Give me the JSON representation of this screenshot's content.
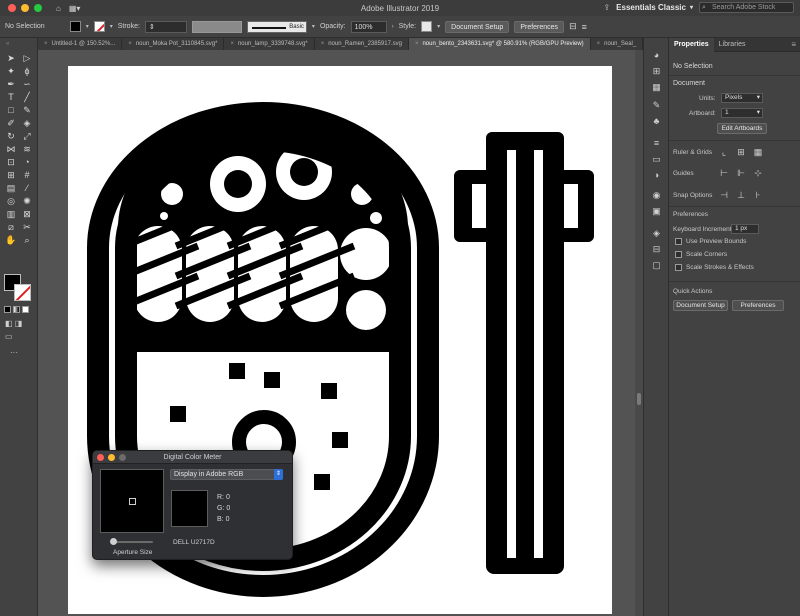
{
  "window": {
    "title": "Adobe Illustrator 2019",
    "workspace": "Essentials Classic",
    "stock_search_placeholder": "Search Adobe Stock"
  },
  "control_bar": {
    "selection": "No Selection",
    "stroke_label": "Stroke:",
    "stroke_style": "Basic",
    "opacity_label": "Opacity:",
    "opacity_value": "100%",
    "style_label": "Style:",
    "document_setup": "Document Setup",
    "preferences": "Preferences"
  },
  "tabs": [
    {
      "label": "Untitled-1 @ 150.52%...",
      "active": false
    },
    {
      "label": "noun_Moka Pot_3110845.svg*",
      "active": false
    },
    {
      "label": "noun_lamp_3339748.svg*",
      "active": false
    },
    {
      "label": "noun_Ramen_2385917.svg",
      "active": false
    },
    {
      "label": "noun_bento_2343631.svg* @ 580.91% (RGB/GPU Preview)",
      "active": true
    },
    {
      "label": "noun_Seal_",
      "active": false
    }
  ],
  "properties": {
    "tab_properties": "Properties",
    "tab_libraries": "Libraries",
    "no_selection": "No Selection",
    "document": "Document",
    "units_label": "Units:",
    "units_value": "Pixels",
    "artboard_label": "Artboard:",
    "artboard_value": "1",
    "edit_artboards": "Edit Artboards",
    "ruler_grids": "Ruler & Grids",
    "guides": "Guides",
    "snap_options": "Snap Options",
    "preferences": "Preferences",
    "keyboard_increment_label": "Keyboard Increment:",
    "keyboard_increment_value": "1 px",
    "use_preview_bounds": "Use Preview Bounds",
    "scale_corners": "Scale Corners",
    "scale_strokes_effects": "Scale Strokes & Effects",
    "quick_actions": "Quick Actions",
    "document_setup": "Document Setup",
    "preferences_btn": "Preferences"
  },
  "color_meter": {
    "title": "Digital Color Meter",
    "mode": "Display in Adobe RGB",
    "r_label": "R:",
    "r_value": "0",
    "g_label": "G:",
    "g_value": "0",
    "b_label": "B:",
    "b_value": "0",
    "aperture_label": "Aperture Size",
    "display_name": "DELL U2717D"
  },
  "colors": {
    "accent": "#2d6fd6",
    "close": "#ff5f57",
    "minimize": "#febc2e",
    "zoom": "#28c840",
    "fill": "#000000",
    "stroke_none_slash": "#e02020"
  }
}
